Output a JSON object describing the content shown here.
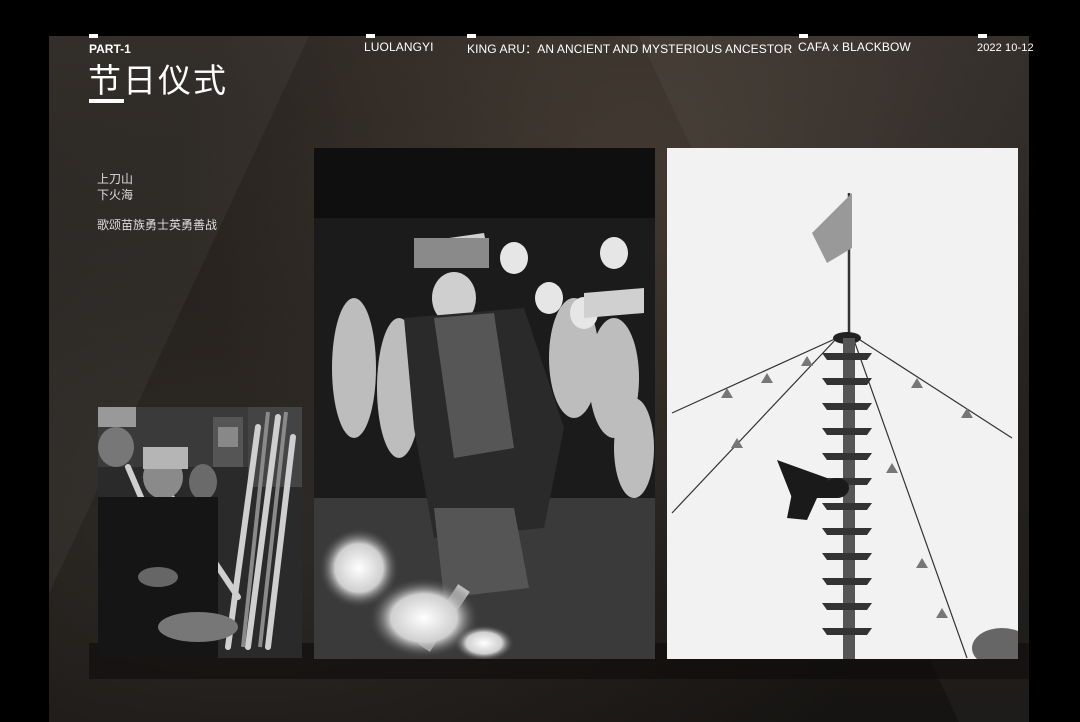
{
  "header": {
    "part_label": "PART-1",
    "title": "节日仪式",
    "nav": [
      "LUOLANGYI",
      "KING ARU：AN ANCIENT AND MYSTERIOUS ANCESTOR",
      "CAFA x BLACKBOW"
    ],
    "date": "2022 10-12"
  },
  "description": {
    "line1": "上刀山",
    "line2": "下火海",
    "line3": "歌颂苗族勇士英勇善战"
  },
  "photos": [
    {
      "icon": "lusheng-players-photo"
    },
    {
      "icon": "fire-walking-dancer-photo"
    },
    {
      "icon": "blade-ladder-pole-photo"
    }
  ]
}
